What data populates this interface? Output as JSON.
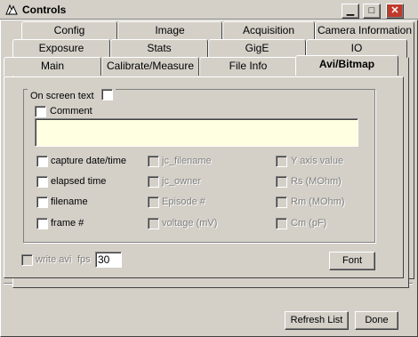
{
  "window": {
    "title": "Controls",
    "min_label": "▁",
    "max_label": "□",
    "close_label": "✕"
  },
  "tabs": {
    "row1": [
      "Config",
      "Image",
      "Acquisition",
      "Camera Information"
    ],
    "row2": [
      "Exposure",
      "Stats",
      "GigE",
      "IO"
    ],
    "row3": [
      "Main",
      "Calibrate/Measure",
      "File Info",
      "Avi/Bitmap"
    ],
    "active": "Avi/Bitmap"
  },
  "group": {
    "legend": "On screen text",
    "comment_label": "Comment",
    "comment_value": "",
    "columns": [
      [
        "capture date/time",
        "elapsed time",
        "filename",
        "frame #"
      ],
      [
        "jc_filename",
        "jc_owner",
        "Episode #",
        "voltage (mV)"
      ],
      [
        "Y axis value",
        "Rs (MOhm)",
        "Rm (MOhm)",
        "Cm (pF)"
      ]
    ]
  },
  "avi": {
    "write_avi_label": "write avi",
    "fps_label": "fps",
    "fps_value": "30",
    "font_button": "Font"
  },
  "footer": {
    "refresh_button": "Refresh List",
    "done_button": "Done"
  },
  "colors": {
    "face": "#d4d0c8",
    "comment_bg": "#ffffe1",
    "disabled_text": "#808080"
  }
}
